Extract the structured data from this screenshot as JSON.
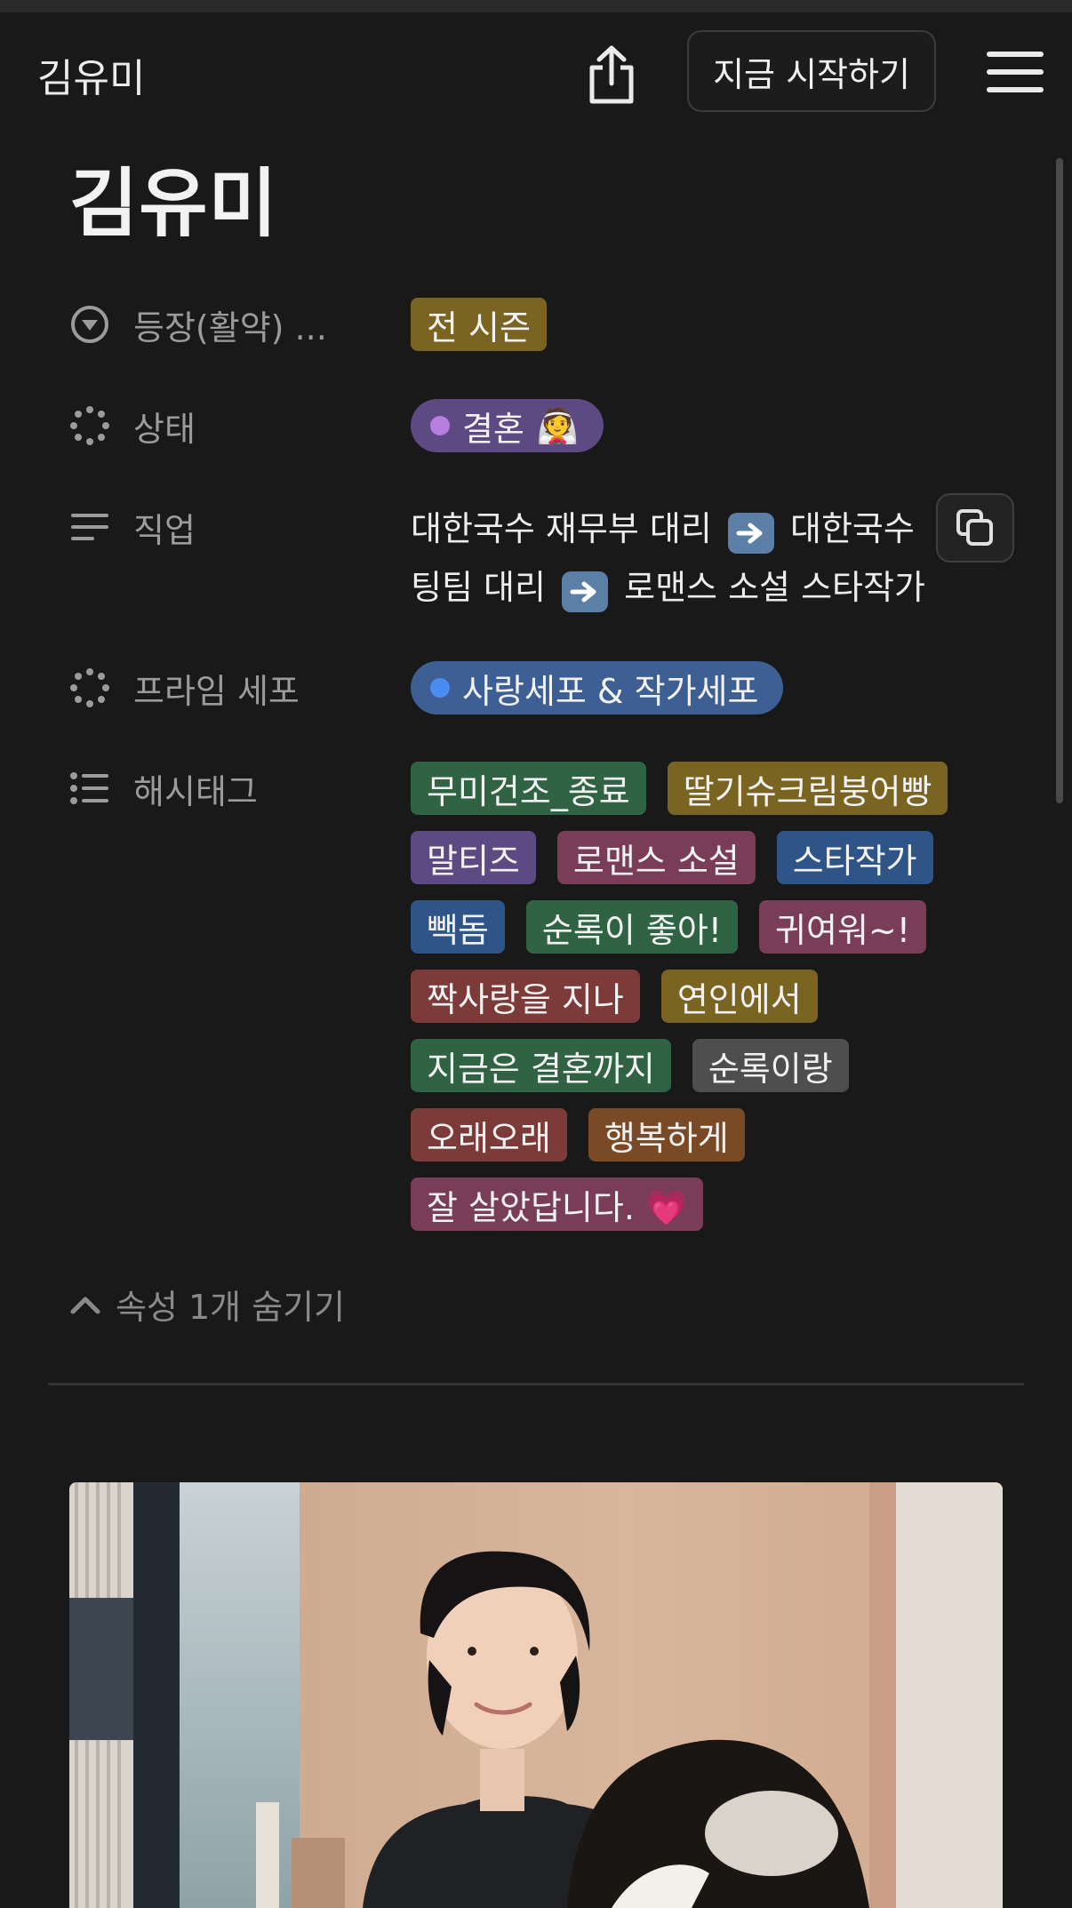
{
  "topbar": {
    "title": "김유미",
    "start_label": "지금 시작하기"
  },
  "page": {
    "title": "김유미"
  },
  "properties": {
    "appearance": {
      "label": "등장(활약) ...",
      "value": "전 시즌",
      "color": "#7a6422"
    },
    "status": {
      "label": "상태",
      "value": "결혼",
      "emoji": "👰",
      "color": "#5e4a82",
      "dot_color": "#b67fe0"
    },
    "job": {
      "label": "직업",
      "line1_a": "대한국수 재무부 대리",
      "line1_b": "대한국수 ",
      "line2_a": "팅팀 대리",
      "line2_b": "로맨스 소설 스타작가"
    },
    "prime_cell": {
      "label": "프라임 세포",
      "value": "사랑세포 & 작가세포",
      "color": "#3e5f93",
      "dot_color": "#4a8df0"
    },
    "hashtags": {
      "label": "해시태그",
      "tags": [
        {
          "text": "무미건조_종료",
          "color": "#2f6344"
        },
        {
          "text": "딸기슈크림붕어빵",
          "color": "#7a6422"
        },
        {
          "text": "말티즈",
          "color": "#5e4a82"
        },
        {
          "text": "로맨스 소설",
          "color": "#7a3d58"
        },
        {
          "text": "스타작가",
          "color": "#2f5488"
        },
        {
          "text": "빽돔",
          "color": "#2f5488"
        },
        {
          "text": "순록이 좋아!",
          "color": "#2f6344"
        },
        {
          "text": "귀여워~!",
          "color": "#7a3d58"
        },
        {
          "text": "짝사랑을 지나",
          "color": "#7c3b38"
        },
        {
          "text": "연인에서",
          "color": "#7a6422"
        },
        {
          "text": "지금은 결혼까지",
          "color": "#2f6344"
        },
        {
          "text": "순록이랑",
          "color": "#4e4e4e"
        },
        {
          "text": "오래오래",
          "color": "#7c3b38"
        },
        {
          "text": "행복하게",
          "color": "#7a4a26"
        },
        {
          "text": "잘 살았답니다. 💗",
          "color": "#7a3d58"
        }
      ]
    }
  },
  "hide_toggle": {
    "label": "속성 1개 숨기기"
  },
  "icons": [
    "share-icon",
    "menu-icon",
    "dropdown-circle-icon",
    "status-spinner-icon",
    "text-lines-icon",
    "list-icon",
    "copy-icon",
    "chevron-up-icon",
    "arrow-right-emoji"
  ]
}
